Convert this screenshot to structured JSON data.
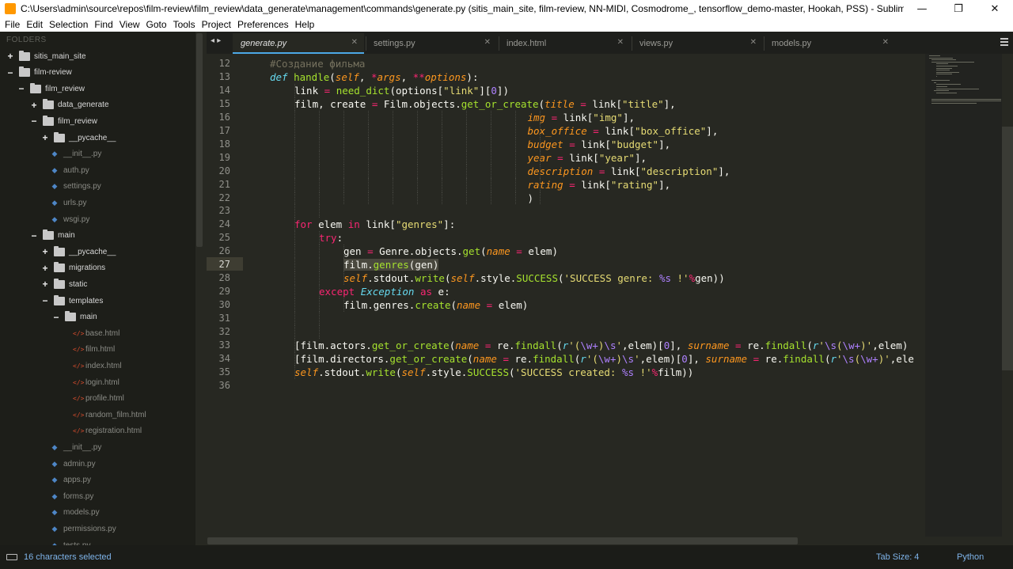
{
  "window": {
    "title": "C:\\Users\\admin\\source\\repos\\film-review\\film_review\\data_generate\\management\\commands\\generate.py (sitis_main_site, film-review, NN-MIDI, Cosmodrome_, tensorflow_demo-master, Hookah, PSS) - Sublime Text",
    "minimize": "—",
    "maximize": "❐",
    "close": "✕"
  },
  "menu": [
    "File",
    "Edit",
    "Selection",
    "Find",
    "View",
    "Goto",
    "Tools",
    "Project",
    "Preferences",
    "Help"
  ],
  "sidebar": {
    "header": "FOLDERS",
    "items": [
      {
        "label": "sitis_main_site",
        "type": "dir",
        "toggle": "+",
        "depth": 0
      },
      {
        "label": "film-review",
        "type": "dir",
        "toggle": "−",
        "depth": 0
      },
      {
        "label": "film_review",
        "type": "dir",
        "toggle": "−",
        "depth": 1
      },
      {
        "label": "data_generate",
        "type": "dir",
        "toggle": "+",
        "depth": 2
      },
      {
        "label": "film_review",
        "type": "dir",
        "toggle": "−",
        "depth": 2
      },
      {
        "label": "__pycache__",
        "type": "dir",
        "toggle": "+",
        "depth": 3
      },
      {
        "label": "__init__.py",
        "type": "py",
        "depth": 3
      },
      {
        "label": "auth.py",
        "type": "py",
        "depth": 3
      },
      {
        "label": "settings.py",
        "type": "py",
        "depth": 3
      },
      {
        "label": "urls.py",
        "type": "py",
        "depth": 3
      },
      {
        "label": "wsgi.py",
        "type": "py",
        "depth": 3
      },
      {
        "label": "main",
        "type": "dir",
        "toggle": "−",
        "depth": 2
      },
      {
        "label": "__pycache__",
        "type": "dir",
        "toggle": "+",
        "depth": 3
      },
      {
        "label": "migrations",
        "type": "dir",
        "toggle": "+",
        "depth": 3
      },
      {
        "label": "static",
        "type": "dir",
        "toggle": "+",
        "depth": 3
      },
      {
        "label": "templates",
        "type": "dir",
        "toggle": "−",
        "depth": 3
      },
      {
        "label": "main",
        "type": "dir",
        "toggle": "−",
        "depth": 4
      },
      {
        "label": "base.html",
        "type": "html",
        "depth": 5
      },
      {
        "label": "film.html",
        "type": "html",
        "depth": 5
      },
      {
        "label": "index.html",
        "type": "html",
        "depth": 5
      },
      {
        "label": "login.html",
        "type": "html",
        "depth": 5
      },
      {
        "label": "profile.html",
        "type": "html",
        "depth": 5
      },
      {
        "label": "random_film.html",
        "type": "html",
        "depth": 5
      },
      {
        "label": "registration.html",
        "type": "html",
        "depth": 5
      },
      {
        "label": "__init__.py",
        "type": "py",
        "depth": 3
      },
      {
        "label": "admin.py",
        "type": "py",
        "depth": 3
      },
      {
        "label": "apps.py",
        "type": "py",
        "depth": 3
      },
      {
        "label": "forms.py",
        "type": "py",
        "depth": 3
      },
      {
        "label": "models.py",
        "type": "py",
        "depth": 3
      },
      {
        "label": "permissions.py",
        "type": "py",
        "depth": 3
      },
      {
        "label": "tests.py",
        "type": "py",
        "depth": 3
      }
    ]
  },
  "tabs": [
    {
      "label": "generate.py",
      "active": true
    },
    {
      "label": "settings.py",
      "active": false
    },
    {
      "label": "index.html",
      "active": false
    },
    {
      "label": "views.py",
      "active": false
    },
    {
      "label": "models.py",
      "active": false
    }
  ],
  "tab_close": "✕",
  "tab_nav": "◂ ▸",
  "editor": {
    "current_line": 27,
    "lines": [
      {
        "n": 12,
        "indent": 1,
        "tokens": [
          [
            "c",
            "#Создание фильма"
          ]
        ]
      },
      {
        "n": 13,
        "indent": 1,
        "tokens": [
          [
            "d",
            "def"
          ],
          [
            "",
            " "
          ],
          [
            "f",
            "handle"
          ],
          [
            "",
            "("
          ],
          [
            "p",
            "self"
          ],
          [
            "",
            ", "
          ],
          [
            "k",
            "*"
          ],
          [
            "p",
            "args"
          ],
          [
            "",
            ", "
          ],
          [
            "k",
            "**"
          ],
          [
            "p",
            "options"
          ],
          [
            "",
            "):"
          ]
        ]
      },
      {
        "n": 14,
        "indent": 2,
        "tokens": [
          [
            "",
            "link "
          ],
          [
            "k",
            "="
          ],
          [
            "",
            " "
          ],
          [
            "f",
            "need_dict"
          ],
          [
            "",
            "(options["
          ],
          [
            "s",
            "\"link\""
          ],
          [
            "",
            "]["
          ],
          [
            "n",
            "0"
          ],
          [
            "",
            "])"
          ]
        ]
      },
      {
        "n": 15,
        "indent": 2,
        "tokens": [
          [
            "",
            "film, create "
          ],
          [
            "k",
            "="
          ],
          [
            "",
            " Film.objects."
          ],
          [
            "f",
            "get_or_create"
          ],
          [
            "",
            "("
          ],
          [
            "p",
            "title"
          ],
          [
            "",
            " "
          ],
          [
            "k",
            "="
          ],
          [
            "",
            " link["
          ],
          [
            "s",
            "\"title\""
          ],
          [
            "",
            "],"
          ]
        ]
      },
      {
        "n": 16,
        "indent": 0,
        "pad": 42,
        "tokens": [
          [
            "p",
            "img"
          ],
          [
            "",
            " "
          ],
          [
            "k",
            "="
          ],
          [
            "",
            " link["
          ],
          [
            "s",
            "\"img\""
          ],
          [
            "",
            "],"
          ]
        ]
      },
      {
        "n": 17,
        "indent": 0,
        "pad": 42,
        "tokens": [
          [
            "p",
            "box_office"
          ],
          [
            "",
            " "
          ],
          [
            "k",
            "="
          ],
          [
            "",
            " link["
          ],
          [
            "s",
            "\"box_office\""
          ],
          [
            "",
            "],"
          ]
        ]
      },
      {
        "n": 18,
        "indent": 0,
        "pad": 42,
        "tokens": [
          [
            "p",
            "budget"
          ],
          [
            "",
            " "
          ],
          [
            "k",
            "="
          ],
          [
            "",
            " link["
          ],
          [
            "s",
            "\"budget\""
          ],
          [
            "",
            "],"
          ]
        ]
      },
      {
        "n": 19,
        "indent": 0,
        "pad": 42,
        "tokens": [
          [
            "p",
            "year"
          ],
          [
            "",
            " "
          ],
          [
            "k",
            "="
          ],
          [
            "",
            " link["
          ],
          [
            "s",
            "\"year\""
          ],
          [
            "",
            "],"
          ]
        ]
      },
      {
        "n": 20,
        "indent": 0,
        "pad": 42,
        "tokens": [
          [
            "p",
            "description"
          ],
          [
            "",
            " "
          ],
          [
            "k",
            "="
          ],
          [
            "",
            " link["
          ],
          [
            "s",
            "\"description\""
          ],
          [
            "",
            "],"
          ]
        ]
      },
      {
        "n": 21,
        "indent": 0,
        "pad": 42,
        "tokens": [
          [
            "p",
            "rating"
          ],
          [
            "",
            " "
          ],
          [
            "k",
            "="
          ],
          [
            "",
            " link["
          ],
          [
            "s",
            "\"rating\""
          ],
          [
            "",
            "],"
          ]
        ]
      },
      {
        "n": 22,
        "indent": 0,
        "pad": 42,
        "tokens": [
          [
            "",
            ")"
          ]
        ]
      },
      {
        "n": 23,
        "indent": 0,
        "tokens": []
      },
      {
        "n": 24,
        "indent": 2,
        "tokens": [
          [
            "k",
            "for"
          ],
          [
            "",
            " elem "
          ],
          [
            "k",
            "in"
          ],
          [
            "",
            " link["
          ],
          [
            "s",
            "\"genres\""
          ],
          [
            "",
            "]:"
          ]
        ]
      },
      {
        "n": 25,
        "indent": 3,
        "tokens": [
          [
            "k",
            "try"
          ],
          [
            "",
            ":"
          ]
        ]
      },
      {
        "n": 26,
        "indent": 4,
        "tokens": [
          [
            "",
            "gen "
          ],
          [
            "k",
            "="
          ],
          [
            "",
            " Genre.objects."
          ],
          [
            "f",
            "get"
          ],
          [
            "",
            "("
          ],
          [
            "p",
            "name"
          ],
          [
            "",
            " "
          ],
          [
            "k",
            "="
          ],
          [
            "",
            " elem)"
          ]
        ]
      },
      {
        "n": 27,
        "indent": 4,
        "tokens": [
          [
            "sel",
            "film."
          ],
          [
            "sel-f",
            "genres"
          ],
          [
            "sel",
            "(gen)"
          ]
        ]
      },
      {
        "n": 28,
        "indent": 4,
        "tokens": [
          [
            "p",
            "self"
          ],
          [
            "",
            ".stdout."
          ],
          [
            "f",
            "write"
          ],
          [
            "",
            "("
          ],
          [
            "p",
            "self"
          ],
          [
            "",
            ".style."
          ],
          [
            "f",
            "SUCCESS"
          ],
          [
            "",
            "("
          ],
          [
            "s",
            "'SUCCESS genre: "
          ],
          [
            "n",
            "%s"
          ],
          [
            "s",
            " !'"
          ],
          [
            "k",
            "%"
          ],
          [
            "",
            "gen))"
          ]
        ]
      },
      {
        "n": 29,
        "indent": 3,
        "tokens": [
          [
            "k",
            "except"
          ],
          [
            "",
            " "
          ],
          [
            "d",
            "Exception"
          ],
          [
            "",
            " "
          ],
          [
            "k",
            "as"
          ],
          [
            "",
            " e:"
          ]
        ]
      },
      {
        "n": 30,
        "indent": 4,
        "tokens": [
          [
            "",
            "film.genres."
          ],
          [
            "f",
            "create"
          ],
          [
            "",
            "("
          ],
          [
            "p",
            "name"
          ],
          [
            "",
            " "
          ],
          [
            "k",
            "="
          ],
          [
            "",
            " elem)"
          ]
        ]
      },
      {
        "n": 31,
        "indent": 0,
        "tokens": []
      },
      {
        "n": 32,
        "indent": 0,
        "tokens": []
      },
      {
        "n": 33,
        "indent": 2,
        "tokens": [
          [
            "",
            "[film.actors."
          ],
          [
            "f",
            "get_or_create"
          ],
          [
            "",
            "("
          ],
          [
            "p",
            "name"
          ],
          [
            "",
            " "
          ],
          [
            "k",
            "="
          ],
          [
            "",
            " re."
          ],
          [
            "f",
            "findall"
          ],
          [
            "",
            "("
          ],
          [
            "d",
            "r"
          ],
          [
            "s",
            "'("
          ],
          [
            "n",
            "\\w+"
          ],
          [
            "s",
            ")"
          ],
          [
            "n",
            "\\s"
          ],
          [
            "s",
            "'"
          ],
          [
            "",
            ",elem)["
          ],
          [
            "n",
            "0"
          ],
          [
            "",
            "], "
          ],
          [
            "p",
            "surname"
          ],
          [
            "",
            " "
          ],
          [
            "k",
            "="
          ],
          [
            "",
            " re."
          ],
          [
            "f",
            "findall"
          ],
          [
            "",
            "("
          ],
          [
            "d",
            "r"
          ],
          [
            "s",
            "'"
          ],
          [
            "n",
            "\\s"
          ],
          [
            "s",
            "("
          ],
          [
            "n",
            "\\w+"
          ],
          [
            "s",
            ")'"
          ],
          [
            "",
            ",elem)"
          ]
        ]
      },
      {
        "n": 34,
        "indent": 2,
        "tokens": [
          [
            "",
            "[film.directors."
          ],
          [
            "f",
            "get_or_create"
          ],
          [
            "",
            "("
          ],
          [
            "p",
            "name"
          ],
          [
            "",
            " "
          ],
          [
            "k",
            "="
          ],
          [
            "",
            " re."
          ],
          [
            "f",
            "findall"
          ],
          [
            "",
            "("
          ],
          [
            "d",
            "r"
          ],
          [
            "s",
            "'("
          ],
          [
            "n",
            "\\w+"
          ],
          [
            "s",
            ")"
          ],
          [
            "n",
            "\\s"
          ],
          [
            "s",
            "'"
          ],
          [
            "",
            ",elem)["
          ],
          [
            "n",
            "0"
          ],
          [
            "",
            "], "
          ],
          [
            "p",
            "surname"
          ],
          [
            "",
            " "
          ],
          [
            "k",
            "="
          ],
          [
            "",
            " re."
          ],
          [
            "f",
            "findall"
          ],
          [
            "",
            "("
          ],
          [
            "d",
            "r"
          ],
          [
            "s",
            "'"
          ],
          [
            "n",
            "\\s"
          ],
          [
            "s",
            "("
          ],
          [
            "n",
            "\\w+"
          ],
          [
            "s",
            ")'"
          ],
          [
            "",
            ",ele"
          ]
        ]
      },
      {
        "n": 35,
        "indent": 2,
        "tokens": [
          [
            "p",
            "self"
          ],
          [
            "",
            ".stdout."
          ],
          [
            "f",
            "write"
          ],
          [
            "",
            "("
          ],
          [
            "p",
            "self"
          ],
          [
            "",
            ".style."
          ],
          [
            "f",
            "SUCCESS"
          ],
          [
            "",
            "("
          ],
          [
            "s",
            "'SUCCESS created: "
          ],
          [
            "n",
            "%s"
          ],
          [
            "s",
            " !'"
          ],
          [
            "k",
            "%"
          ],
          [
            "",
            "film))"
          ]
        ]
      },
      {
        "n": 36,
        "indent": 0,
        "tokens": []
      }
    ]
  },
  "status": {
    "selection": "16 characters selected",
    "tab_size": "Tab Size: 4",
    "syntax": "Python"
  },
  "colors": {
    "background": "#272822",
    "keyword": "#f92672",
    "function": "#a6e22e",
    "parameter": "#fd971f",
    "string": "#e6db74",
    "number": "#ae81ff",
    "comment": "#75715e",
    "storage": "#66d9ef",
    "status_accent": "#7fb4ea",
    "tab_accent": "#4ca8e6"
  }
}
